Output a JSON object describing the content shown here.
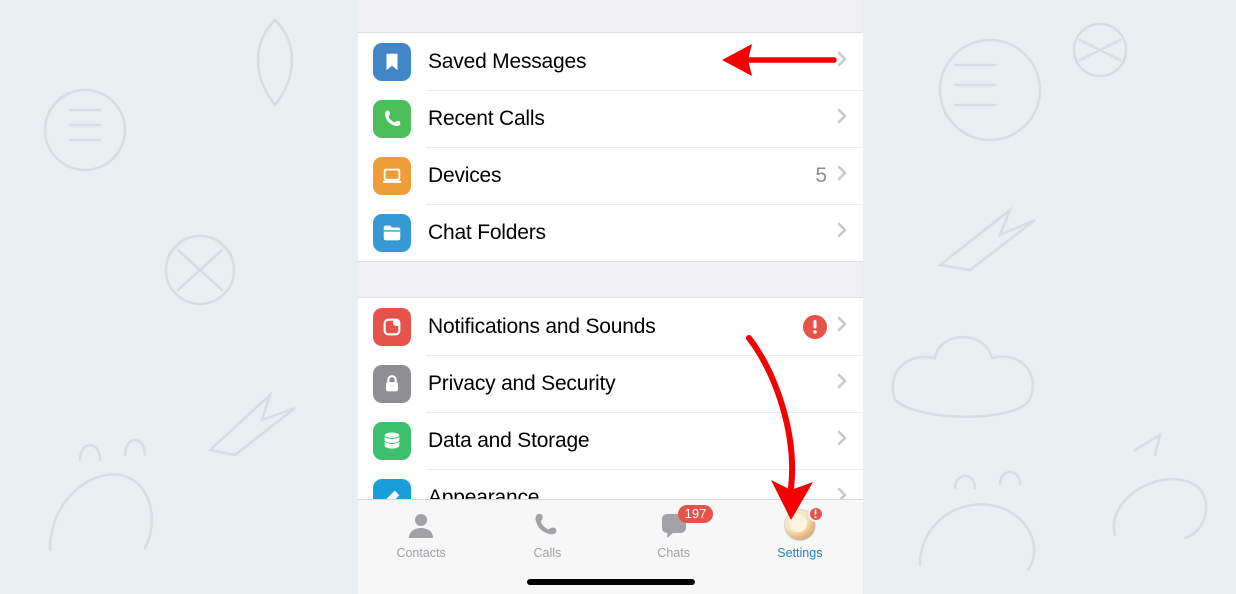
{
  "colors": {
    "blue": "#4186c7",
    "green": "#4cbf5a",
    "orange": "#ed9e39",
    "skyblue": "#359ad4",
    "red": "#e5534b",
    "gray": "#8e8e93",
    "greenAlt": "#3cc06e",
    "brush": "#189ed8"
  },
  "groups": [
    {
      "items": [
        {
          "key": "saved",
          "label": "Saved Messages",
          "icon": "bookmark",
          "iconBg": "#4186c7"
        },
        {
          "key": "calls",
          "label": "Recent Calls",
          "icon": "phone",
          "iconBg": "#4cbf5a"
        },
        {
          "key": "devices",
          "label": "Devices",
          "badge": "5",
          "icon": "laptop",
          "iconBg": "#ed9e39"
        },
        {
          "key": "folders",
          "label": "Chat Folders",
          "icon": "folder",
          "iconBg": "#359ad4"
        }
      ]
    },
    {
      "items": [
        {
          "key": "notif",
          "label": "Notifications and Sounds",
          "alert": true,
          "icon": "bell-app",
          "iconBg": "#e5534b"
        },
        {
          "key": "privacy",
          "label": "Privacy and Security",
          "icon": "lock",
          "iconBg": "#8e8e93"
        },
        {
          "key": "data",
          "label": "Data and Storage",
          "icon": "stack",
          "iconBg": "#3cc06e"
        },
        {
          "key": "appear",
          "label": "Appearance",
          "icon": "brush",
          "iconBg": "#189ed8"
        }
      ]
    }
  ],
  "tabs": {
    "contacts": "Contacts",
    "calls": "Calls",
    "chats": "Chats",
    "settings": "Settings",
    "chats_badge": "197"
  }
}
